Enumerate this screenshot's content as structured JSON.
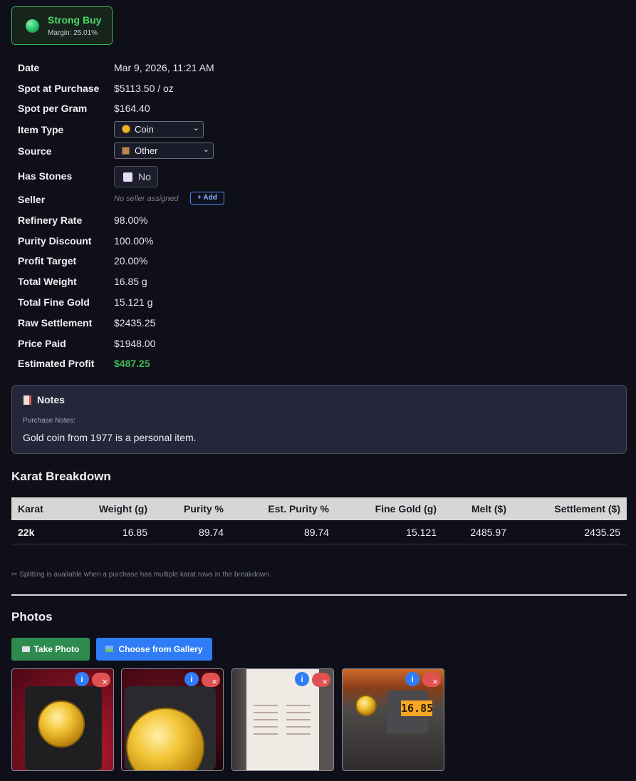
{
  "signal": {
    "label": "Strong Buy",
    "margin": "Margin: 25.01%",
    "color": "#4cd964"
  },
  "details": {
    "date_label": "Date",
    "date_value": "Mar 9, 2026, 11:21 AM",
    "spot_label": "Spot at Purchase",
    "spot_value": "$5113.50 / oz",
    "spot_gram_label": "Spot per Gram",
    "spot_gram_value": "$164.40",
    "item_type_label": "Item Type",
    "item_type_value": "Coin",
    "source_label": "Source",
    "source_value": "Other",
    "stones_label": "Has Stones",
    "stones_value": "No",
    "seller_label": "Seller",
    "seller_value": "No seller assigned",
    "seller_add": "+ Add",
    "refinery_label": "Refinery Rate",
    "refinery_value": "98.00%",
    "purity_label": "Purity Discount",
    "purity_value": "100.00%",
    "profit_target_label": "Profit Target",
    "profit_target_value": "20.00%",
    "weight_label": "Total Weight",
    "weight_value": "16.85 g",
    "fine_label": "Total Fine Gold",
    "fine_value": "15.121 g",
    "raw_label": "Raw Settlement",
    "raw_value": "$2435.25",
    "paid_label": "Price Paid",
    "paid_value": "$1948.00",
    "est_profit_label": "Estimated Profit",
    "est_profit_value": "$487.25"
  },
  "notes": {
    "title": "Notes",
    "sub_label": "Purchase Notes:",
    "text": "Gold coin from 1977 is a personal item."
  },
  "karat": {
    "title": "Karat Breakdown",
    "headers": [
      "Karat",
      "Weight (g)",
      "Purity %",
      "Est. Purity %",
      "Fine Gold (g)",
      "Melt ($)",
      "Settlement ($)"
    ],
    "rows": [
      [
        "22k",
        "16.85",
        "89.74",
        "89.74",
        "15.121",
        "2485.97",
        "2435.25"
      ]
    ],
    "split_note": "✂ Splitting is available when a purchase has multiple karat rows in the breakdown."
  },
  "photos": {
    "title": "Photos",
    "take_label": "Take Photo",
    "gallery_label": "Choose from Gallery",
    "info_symbol": "i",
    "delete_symbol": "×",
    "scale_reading": "16.85",
    "items": [
      "coin-in-case-front",
      "coin-in-case-portrait",
      "certificate-of-authenticity",
      "coin-on-scale"
    ]
  },
  "colors": {
    "background": "#0f0f1a",
    "accent_green": "#3fb950",
    "accent_blue": "#2f7cf6",
    "danger": "#e05252"
  }
}
